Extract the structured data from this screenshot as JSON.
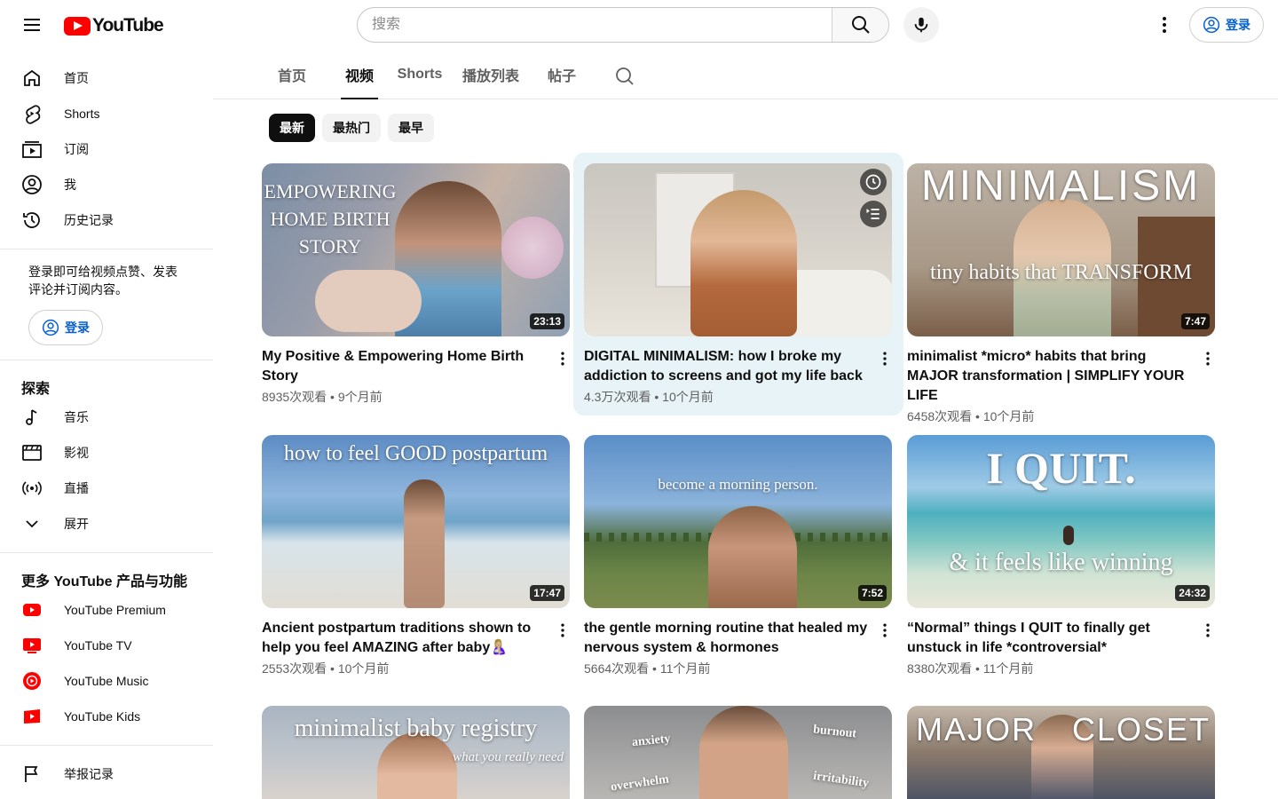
{
  "header": {
    "logo_text": "YouTube",
    "search_placeholder": "搜索",
    "signin_label": "登录"
  },
  "sidebar": {
    "main_items": [
      {
        "label": "首页",
        "icon": "home-icon"
      },
      {
        "label": "Shorts",
        "icon": "shorts-icon"
      },
      {
        "label": "订阅",
        "icon": "subscriptions-icon"
      },
      {
        "label": "我",
        "icon": "you-icon"
      },
      {
        "label": "历史记录",
        "icon": "history-icon"
      }
    ],
    "signin_prompt": "登录即可给视频点赞、发表评论并订阅内容。",
    "signin_label": "登录",
    "explore_title": "探索",
    "explore_items": [
      {
        "label": "音乐",
        "icon": "music-icon"
      },
      {
        "label": "影视",
        "icon": "movies-icon"
      },
      {
        "label": "直播",
        "icon": "live-icon"
      },
      {
        "label": "展开",
        "icon": "chevron-down-icon"
      }
    ],
    "more_title": "更多 YouTube 产品与功能",
    "more_items": [
      {
        "label": "YouTube Premium",
        "icon": "youtube-premium-icon"
      },
      {
        "label": "YouTube TV",
        "icon": "youtube-tv-icon"
      },
      {
        "label": "YouTube Music",
        "icon": "youtube-music-icon"
      },
      {
        "label": "YouTube Kids",
        "icon": "youtube-kids-icon"
      }
    ],
    "report_label": "举报记录"
  },
  "tabs": [
    "首页",
    "视频",
    "Shorts",
    "播放列表",
    "帖子"
  ],
  "active_tab": "视频",
  "chips": [
    "最新",
    "最热门",
    "最早"
  ],
  "videos": [
    {
      "title": "My Positive & Empowering Home Birth Story",
      "views": "8935次观看",
      "age": "9个月前",
      "duration": "23:13",
      "thumb_text": "EMPOWERING HOME BIRTH STORY"
    },
    {
      "title": "DIGITAL MINIMALISM: how I broke my addiction to screens and got my life back",
      "views": "4.3万次观看",
      "age": "10个月前",
      "duration": "",
      "thumb_text": ""
    },
    {
      "title": "minimalist *micro* habits that bring MAJOR transformation | SIMPLIFY YOUR LIFE",
      "views": "6458次观看",
      "age": "10个月前",
      "duration": "7:47",
      "thumb_text": "MINIMALISM",
      "thumb_sub": "tiny habits that TRANSFORM"
    },
    {
      "title": "Ancient postpartum traditions shown to help you feel AMAZING after baby🤱🏼",
      "views": "2553次观看",
      "age": "10个月前",
      "duration": "17:47",
      "thumb_text": "how to feel GOOD postpartum"
    },
    {
      "title": "the gentle morning routine that healed my nervous system & hormones",
      "views": "5664次观看",
      "age": "11个月前",
      "duration": "7:52",
      "thumb_text": "become a morning person."
    },
    {
      "title": "“Normal” things I QUIT to finally get unstuck in life *controversial*",
      "views": "8380次观看",
      "age": "11个月前",
      "duration": "24:32",
      "thumb_text": "I QUIT.",
      "thumb_sub": "& it feels like winning"
    },
    {
      "thumb_text": "minimalist baby registry",
      "thumb_sub": "what you really need"
    },
    {
      "thumb_text": "anxiety",
      "thumb_sub": "burnout",
      "thumb_sub2": "overwhelm",
      "thumb_sub3": "irritability"
    },
    {
      "thumb_text": "MAJOR",
      "thumb_sub": "CLOSET"
    }
  ],
  "meta_separator": " • ",
  "colors": {
    "brand_red": "#ff0000",
    "link_blue": "#065fd4",
    "hover_bg": "#e8f3f8"
  }
}
